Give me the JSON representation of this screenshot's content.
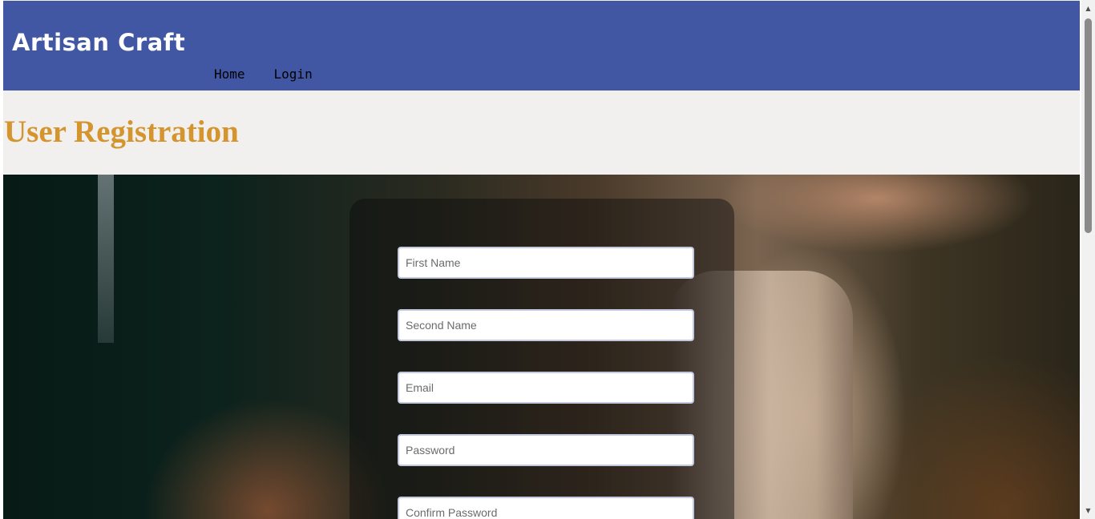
{
  "header": {
    "brand": "Artisan Craft",
    "nav": [
      {
        "label": "Home"
      },
      {
        "label": "Login"
      }
    ],
    "background_color": "#4157a3"
  },
  "page": {
    "title": "User Registration",
    "title_color": "#d4952f"
  },
  "form": {
    "fields": [
      {
        "placeholder": "First Name",
        "value": ""
      },
      {
        "placeholder": "Second Name",
        "value": ""
      },
      {
        "placeholder": "Email",
        "value": ""
      },
      {
        "placeholder": "Password",
        "value": ""
      },
      {
        "placeholder": "Confirm Password",
        "value": ""
      }
    ]
  },
  "scrollbar": {
    "up_icon": "triangle-up",
    "down_icon": "triangle-down"
  }
}
